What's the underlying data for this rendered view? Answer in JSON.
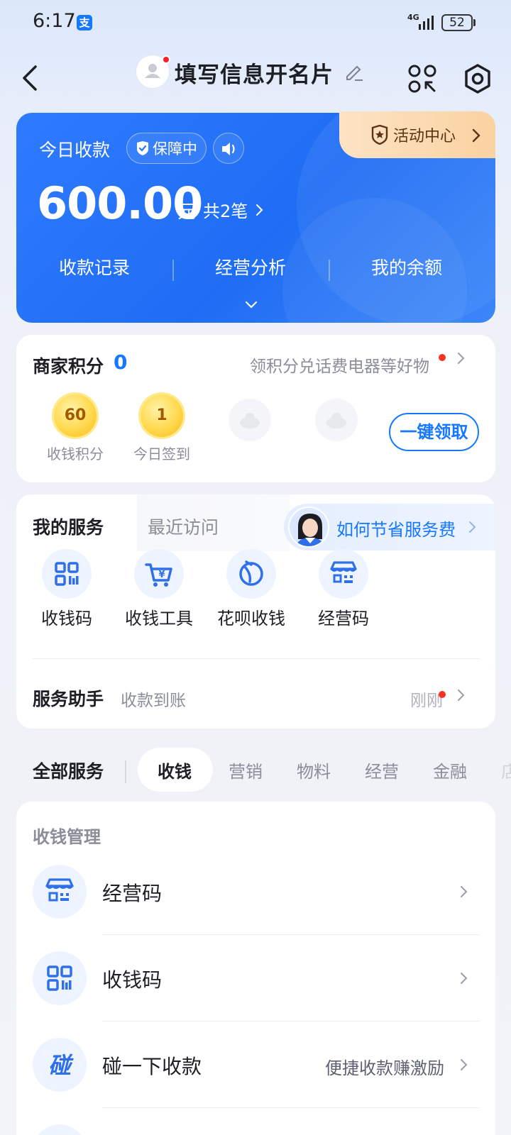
{
  "status_bar": {
    "time": "6:17",
    "network": "4G",
    "battery": "52"
  },
  "header": {
    "title": "填写信息开名片"
  },
  "revenue_card": {
    "activity_center": "活动中心",
    "today_label": "今日收款",
    "protect_badge": "保障中",
    "amount": "600.00",
    "unit": "元",
    "count": "共2笔",
    "links": [
      "收款记录",
      "经营分析",
      "我的余额"
    ]
  },
  "points": {
    "title": "商家积分",
    "value": "0",
    "promo": "领积分兑话费电器等好物",
    "items": [
      {
        "coin": "60",
        "label": "收钱积分"
      },
      {
        "coin": "1",
        "label": "今日签到"
      }
    ],
    "claim_button": "一键领取"
  },
  "services": {
    "tab_active": "我的服务",
    "tab_inactive": "最近访问",
    "promo": "如何节省服务费",
    "items": [
      "收钱码",
      "收钱工具",
      "花呗收钱",
      "经营码"
    ],
    "assistant_title": "服务助手",
    "assistant_sub": "收款到账",
    "assistant_time": "刚刚"
  },
  "categories": {
    "all": "全部服务",
    "items": [
      "收钱",
      "营销",
      "物料",
      "经营",
      "金融",
      "店"
    ]
  },
  "manage": {
    "title": "收钱管理",
    "rows": [
      {
        "label": "经营码",
        "sub": ""
      },
      {
        "label": "收钱码",
        "sub": ""
      },
      {
        "label": "碰一下收款",
        "sub": "便捷收款赚激励",
        "icon_text": "碰"
      }
    ]
  },
  "colors": {
    "accent": "#1677ff",
    "card_blue": "#2a74fb",
    "red_dot": "#f5331f"
  }
}
